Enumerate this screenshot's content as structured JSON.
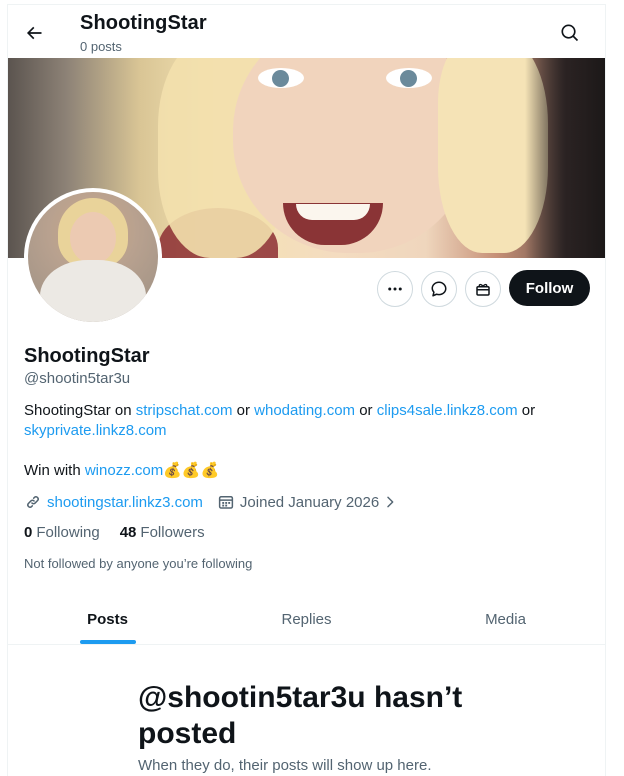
{
  "header": {
    "title": "ShootingStar",
    "subtitle": "0 posts"
  },
  "profile": {
    "display_name": "ShootingStar",
    "handle": "@shootin5tar3u",
    "bio_line1_prefix": "ShootingStar on ",
    "bio_link1": "stripschat.com",
    "bio_or1": " or ",
    "bio_link2": "whodating.com",
    "bio_or2": " or ",
    "bio_link3": "clips4sale.linkz8.com",
    "bio_or3": " or ",
    "bio_link4": "skyprivate.linkz8.com",
    "bio_line2_prefix": "Win with ",
    "bio_link5": "winozz.com",
    "bio_emojis": "💰💰💰",
    "website": "shootingstar.linkz3.com",
    "joined": "Joined January 2026",
    "following_count": "0",
    "following_label": "Following",
    "followers_count": "48",
    "followers_label": "Followers",
    "not_followed": "Not followed by anyone you’re following"
  },
  "actions": {
    "follow_label": "Follow"
  },
  "tabs": [
    {
      "label": "Posts",
      "active": true
    },
    {
      "label": "Replies",
      "active": false
    },
    {
      "label": "Media",
      "active": false
    }
  ],
  "empty_state": {
    "title": "@shootin5tar3u hasn’t posted",
    "subtitle": "When they do, their posts will show up here."
  },
  "icons": {
    "back": "arrow-left-icon",
    "search": "search-icon",
    "more": "more-icon",
    "message": "message-icon",
    "gift": "gift-icon",
    "link": "link-icon",
    "calendar": "calendar-icon",
    "chevron": "chevron-right-icon"
  },
  "colors": {
    "link": "#1d9bf0",
    "text": "#0f1419",
    "muted": "#536471",
    "follow_bg": "#0f1419"
  }
}
